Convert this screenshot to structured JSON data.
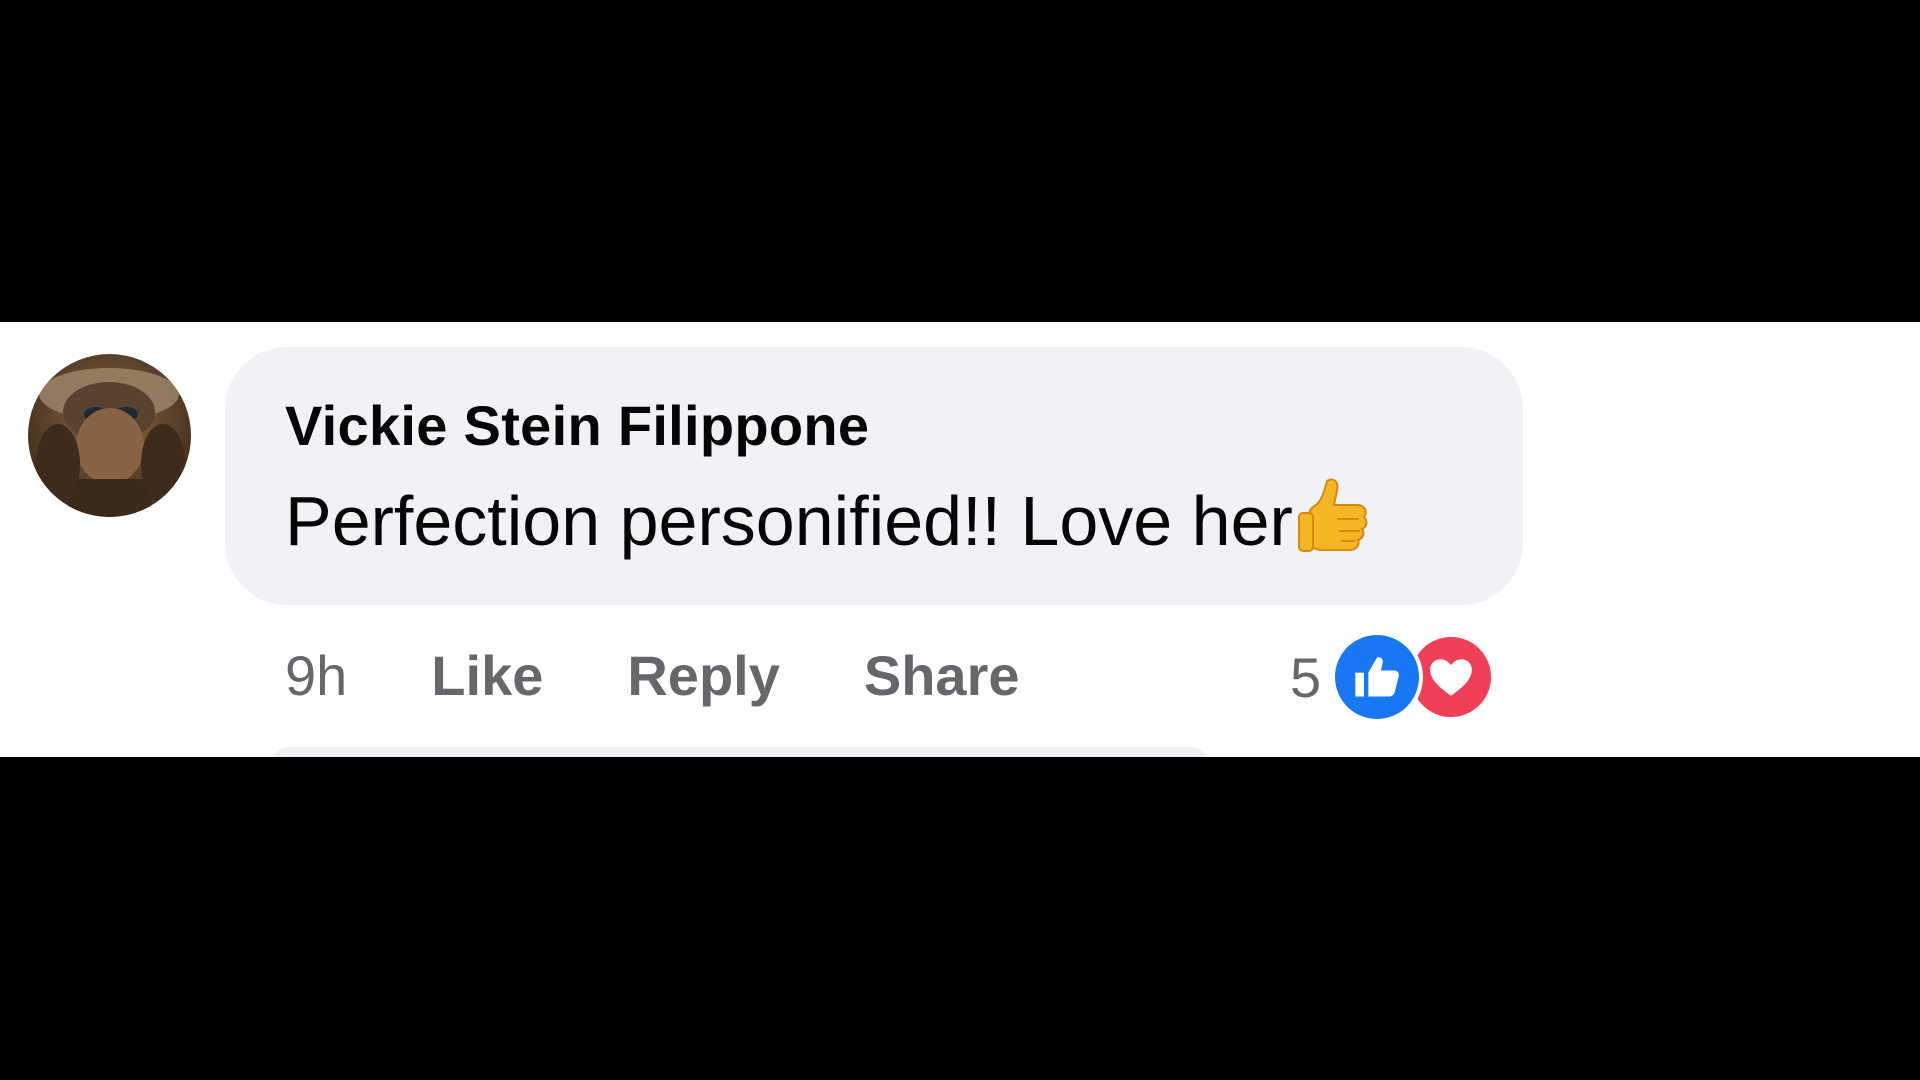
{
  "comment": {
    "author": "Vickie Stein Filippone",
    "text": "Perfection personified!! Love her",
    "emoji": "thumbs-up-emoji"
  },
  "actions": {
    "time": "9h",
    "like": "Like",
    "reply": "Reply",
    "share": "Share"
  },
  "reactions": {
    "count": "5",
    "types": [
      "like-icon",
      "love-icon"
    ]
  },
  "colors": {
    "bubble": "#f0f2f5",
    "text": "#050505",
    "secondary_text": "#65676b",
    "like_blue": "#1877f2",
    "love_red": "#f33e58"
  }
}
